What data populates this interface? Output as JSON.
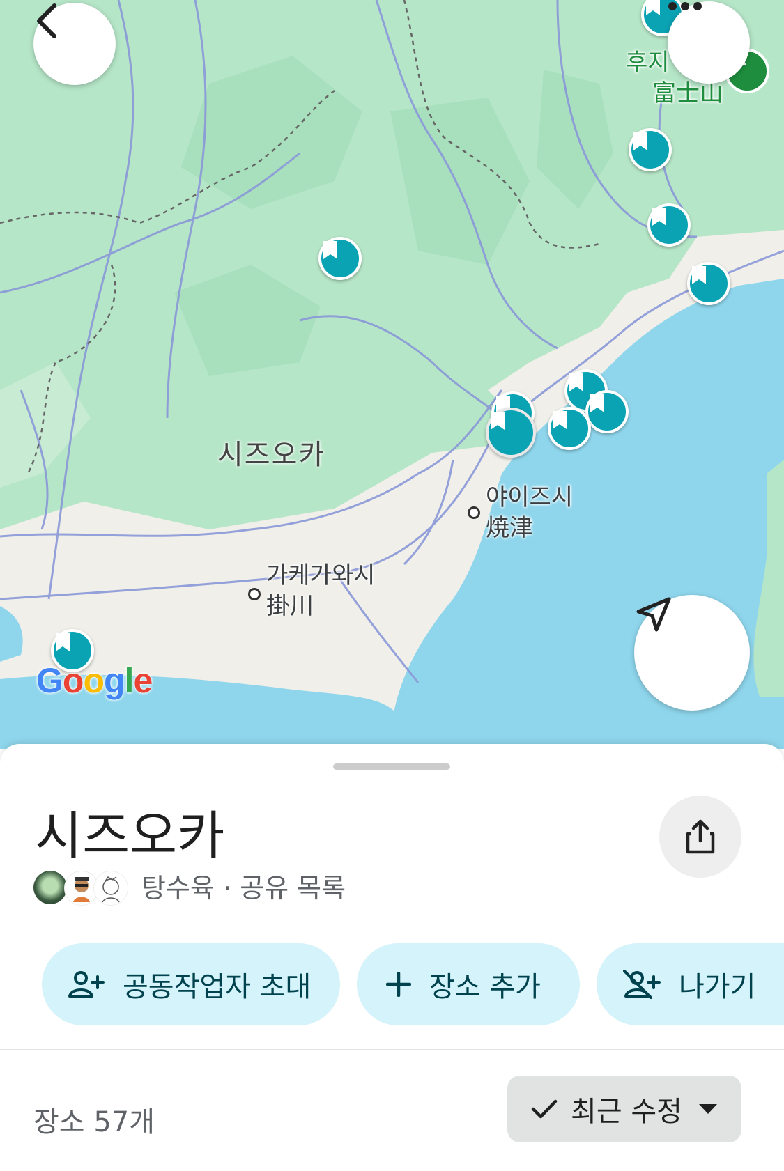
{
  "map": {
    "labels": {
      "region": "시즈오카",
      "yaizu_ko": "야이즈시",
      "yaizu_ja": "焼津",
      "kakegawa_ko": "가케가와시",
      "kakegawa_ja": "掛川",
      "fuji_ko": "후지",
      "fuji_ja": "富士山"
    },
    "google_logo": {
      "g1": "G",
      "o1": "o",
      "o2": "o",
      "g2": "g",
      "l": "l",
      "e": "e"
    },
    "colors": {
      "land": "#b6e6c8",
      "water": "#8fd6ec",
      "pin": "#0aa3b4",
      "road": "#8a98d8"
    }
  },
  "header": {
    "back_icon": "chevron-left-icon",
    "more_icon": "more-horizontal-icon"
  },
  "locate_icon": "navigation-arrow-icon",
  "sheet": {
    "title": "시즈오카",
    "meta": "탕수육 · 공유 목록",
    "share_icon": "share-icon",
    "actions": [
      {
        "label": "공동작업자 초대",
        "icon": "person-add-icon"
      },
      {
        "label": "장소 추가",
        "icon": "plus-icon"
      },
      {
        "label": "나가기",
        "icon": "leave-list-icon"
      }
    ],
    "count": "장소 57개",
    "sort_label": "최근 수정",
    "colors": {
      "chip_bg": "#d4f3fa",
      "chip_text": "#00424d"
    }
  }
}
